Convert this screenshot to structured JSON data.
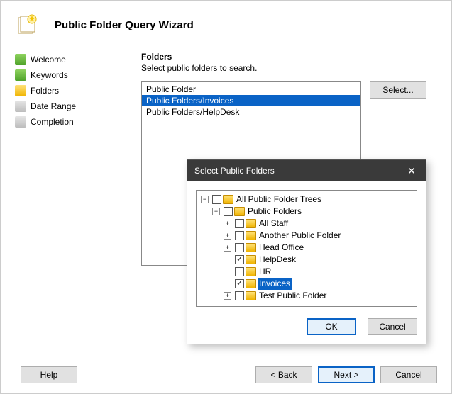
{
  "header": {
    "title": "Public Folder Query Wizard"
  },
  "sidebar": {
    "items": [
      {
        "label": "Welcome",
        "state": "green"
      },
      {
        "label": "Keywords",
        "state": "green"
      },
      {
        "label": "Folders",
        "state": "yellow"
      },
      {
        "label": "Date Range",
        "state": "grey"
      },
      {
        "label": "Completion",
        "state": "grey"
      }
    ]
  },
  "main": {
    "section_title": "Folders",
    "section_sub": "Select public folders to search.",
    "select_label": "Select...",
    "list": [
      {
        "text": "Public Folder",
        "selected": false
      },
      {
        "text": "Public Folders/Invoices",
        "selected": true
      },
      {
        "text": "Public Folders/HelpDesk",
        "selected": false
      }
    ]
  },
  "footer": {
    "help": "Help",
    "back": "< Back",
    "next": "Next >",
    "cancel": "Cancel"
  },
  "modal": {
    "title": "Select Public Folders",
    "ok": "OK",
    "cancel": "Cancel",
    "tree": {
      "n0": "All Public Folder Trees",
      "n1": "Public Folders",
      "n2": "All Staff",
      "n3": "Another Public Folder",
      "n4": "Head Office",
      "n5": "HelpDesk",
      "n6": "HR",
      "n7": "Invoices",
      "n8": "Test Public Folder"
    }
  }
}
